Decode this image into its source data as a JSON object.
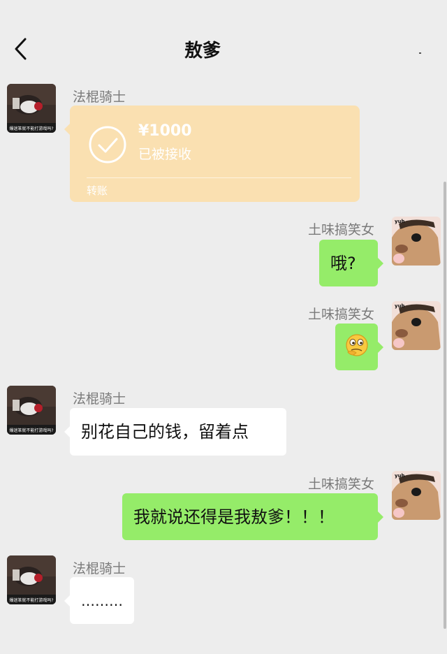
{
  "header": {
    "title": "敖爹",
    "back_icon": "chevron-left-icon"
  },
  "contacts": {
    "left_name": "法棍骑士",
    "right_name": "土味搞笑女",
    "left_avatar_caption": "爆迷笨就不能打游戏吗?",
    "right_avatar_caption": "yuh"
  },
  "messages": [
    {
      "sender": "法棍骑士",
      "type": "transfer",
      "amount": "¥1000",
      "status": "已被接收",
      "label": "转账"
    },
    {
      "sender": "土味搞笑女",
      "type": "text",
      "text": "哦?"
    },
    {
      "sender": "土味搞笑女",
      "type": "sticker",
      "icon": "thinking-face-emoji-icon"
    },
    {
      "sender": "法棍骑士",
      "type": "text",
      "text": "别花自己的钱，留着点"
    },
    {
      "sender": "土味搞笑女",
      "type": "text",
      "text": "我就说还得是我敖爹！！！"
    },
    {
      "sender": "法棍骑士",
      "type": "text",
      "text": "………"
    }
  ],
  "colors": {
    "background": "#ededed",
    "outgoing_bubble": "#95ec69",
    "incoming_bubble": "#ffffff",
    "transfer_card": "#fae0b1"
  }
}
